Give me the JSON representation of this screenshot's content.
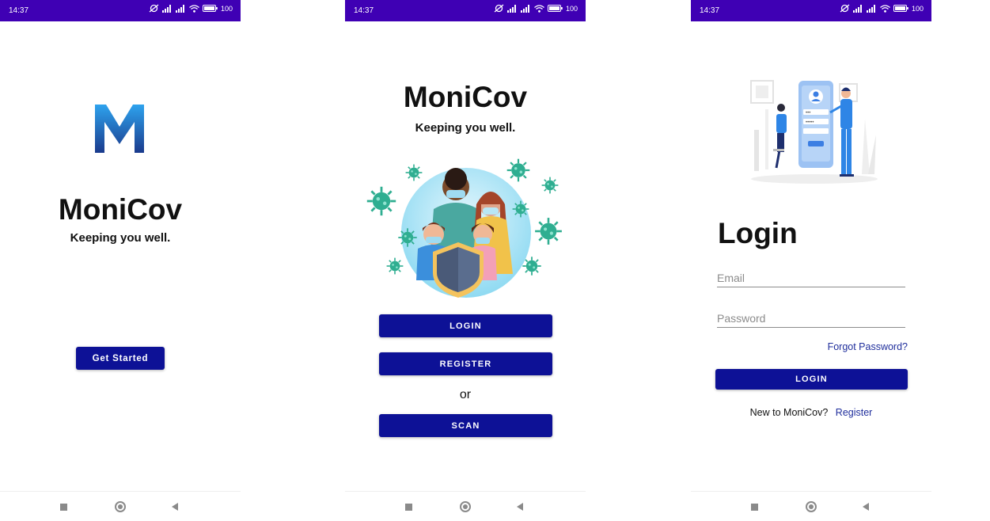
{
  "status_bar": {
    "time": "14:37",
    "battery": "100"
  },
  "screen_splash": {
    "app_name": "MoniCov",
    "tagline": "Keeping you well.",
    "get_started_label": "Get Started"
  },
  "screen_welcome": {
    "app_name": "MoniCov",
    "tagline": "Keeping you well.",
    "login_label": "LOGIN",
    "register_label": "REGISTER",
    "or_text": "or",
    "scan_label": "SCAN"
  },
  "screen_login": {
    "title": "Login",
    "email_placeholder": "Email",
    "password_placeholder": "Password",
    "forgot_label": "Forgot Password?",
    "login_label": "LOGIN",
    "new_user_text": "New to MoniCov?",
    "register_link": "Register"
  },
  "colors": {
    "status_bar": "#3f00b4",
    "button": "#0d1196",
    "link": "#1f2e9c"
  },
  "icons": [
    "dnd-off-icon",
    "signal-icon",
    "wifi-icon",
    "battery-icon",
    "recents-icon",
    "home-icon",
    "back-icon",
    "monicov-logo-icon"
  ]
}
